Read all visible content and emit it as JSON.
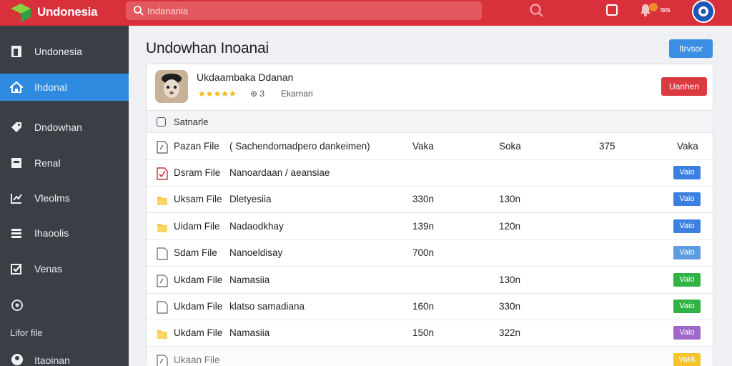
{
  "app": {
    "name": "Undonesia"
  },
  "search": {
    "placeholder": "Indanania",
    "value": ""
  },
  "topbar": {
    "notifications_count": "ᴓᴓ"
  },
  "sidebar": {
    "items": [
      {
        "label": "Undonesia",
        "icon": "document-icon",
        "active": false
      },
      {
        "label": "Ihdonal",
        "icon": "home-icon",
        "active": true
      },
      {
        "label": "Dndowhan",
        "icon": "tag-icon",
        "active": false
      },
      {
        "label": "Renal",
        "icon": "box-icon",
        "active": false
      },
      {
        "label": "Vleolms",
        "icon": "chart-icon",
        "active": false
      },
      {
        "label": "Ihaoolis",
        "icon": "list-icon",
        "active": false
      },
      {
        "label": "Venas",
        "icon": "check-icon",
        "active": false
      }
    ],
    "footer": [
      "Lifor file",
      "Itaoinan"
    ]
  },
  "page": {
    "title": "Undowhan Inoanai",
    "action_label": "Itrvsor"
  },
  "profile": {
    "name": "Ukdaambaka Ddanan",
    "stars": "★★★★★",
    "rating": "⊕ 3",
    "subtitle": "Ekarnari",
    "action_label": "Uanhen"
  },
  "section": {
    "label": "Satnarle"
  },
  "files": {
    "header": {
      "name": "Pazan File",
      "desc": "( Sachendomadpero dankeimen)",
      "a": "Vaka",
      "b": "Soka",
      "c": "375",
      "d": "Vaka"
    },
    "rows": [
      {
        "name": "Dsram File",
        "desc": "Nanoardaan / aeansiae",
        "a": "",
        "b": "",
        "pill": "Vaio",
        "pill_color": "#3b7fe0",
        "icon": "checked-file-icon"
      },
      {
        "name": "Uksam File",
        "desc": "Dletyesiia",
        "a": "330n",
        "b": "130n",
        "pill": "Vaio",
        "pill_color": "#3b7fe0",
        "icon": "folder-icon"
      },
      {
        "name": "Uidam File",
        "desc": "Nadaodkhay",
        "a": "139n",
        "b": "120n",
        "pill": "Vaio",
        "pill_color": "#3b7fe0",
        "icon": "folder-icon"
      },
      {
        "name": "Sdam File",
        "desc": "Nanoeldisay",
        "a": "700n",
        "b": "",
        "pill": "Vaio",
        "pill_color": "#5e9be0",
        "icon": "file-icon"
      },
      {
        "name": "Ukdam File",
        "desc": "Namasiia",
        "a": "",
        "b": "130n",
        "pill": "Vaio",
        "pill_color": "#2fb344",
        "icon": "edit-file-icon"
      },
      {
        "name": "Ukdam File",
        "desc": "klatso samadiana",
        "a": "160n",
        "b": "330n",
        "pill": "Vaio",
        "pill_color": "#2fb344",
        "icon": "file-icon"
      },
      {
        "name": "Ukdam File",
        "desc": "Namasiia",
        "a": "150n",
        "b": "322n",
        "pill": "Vaio",
        "pill_color": "#a067c8",
        "icon": "folder-icon"
      },
      {
        "name": "Ukaan File",
        "desc": "",
        "a": "",
        "b": "",
        "pill": "Vakk",
        "pill_color": "#f5c32c",
        "icon": "edit-file-icon"
      }
    ]
  }
}
